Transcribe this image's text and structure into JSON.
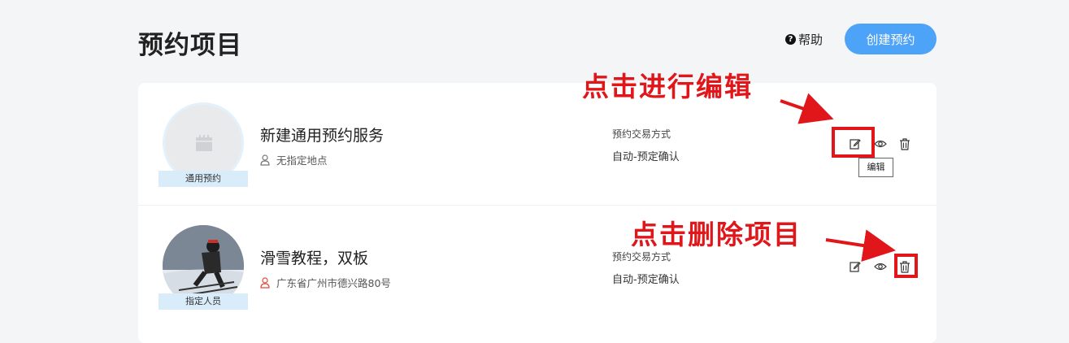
{
  "header": {
    "title": "预约项目",
    "help_label": "帮助",
    "help_icon_glyph": "?",
    "create_button_label": "创建预约"
  },
  "items": [
    {
      "name": "新建通用预约服务",
      "location": "无指定地点",
      "type_tag": "通用预约",
      "method_label": "预约交易方式",
      "method_value": "自动-预定确认",
      "avatar": "placeholder-calendar-icon"
    },
    {
      "name": "滑雪教程，双板",
      "location": "广东省广州市德兴路80号",
      "type_tag": "指定人员",
      "method_label": "预约交易方式",
      "method_value": "自动-预定确认",
      "avatar": "skier-photo"
    }
  ],
  "tooltip": {
    "edit": "编辑"
  },
  "annotations": {
    "edit_hint": "点击进行编辑",
    "delete_hint": "点击删除项目"
  },
  "colors": {
    "accent_blue": "#4da3f7",
    "annotation_red": "#e0161b",
    "tag_bg": "#d8ecfa",
    "page_bg": "#f4f5f7"
  },
  "icons": {
    "location_default": "person-pin-icon",
    "location_set": "person-pin-icon-red",
    "edit": "edit-icon",
    "view": "eye-icon",
    "delete": "trash-icon"
  }
}
